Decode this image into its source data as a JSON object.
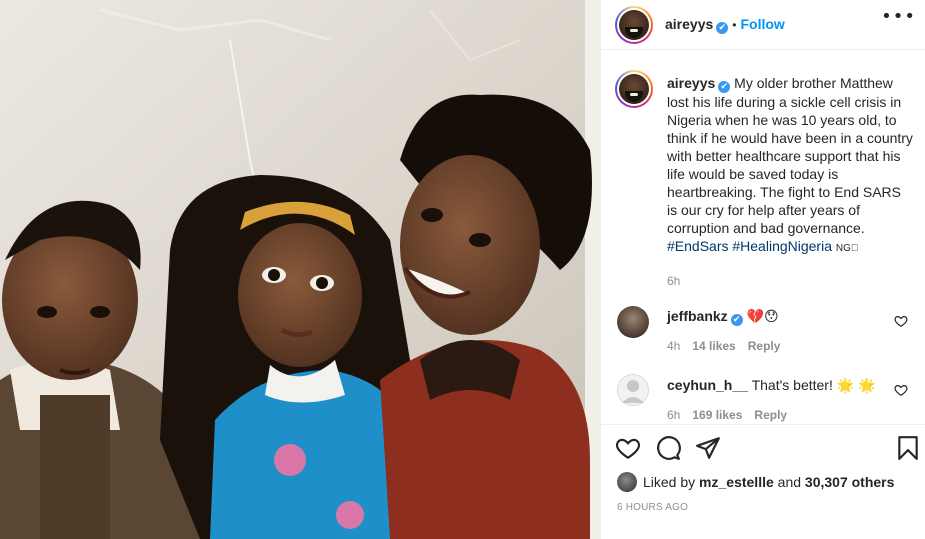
{
  "post": {
    "username": "aireyys",
    "verified_mark": "✔",
    "separator": "•",
    "follow_label": "Follow",
    "more_label": "•••",
    "caption_username": "aireyys",
    "caption_body": "My older brother Matthew lost his life during a sickle cell crisis in Nigeria when he was 10 years old, to think if he would have been in a country with better healthcare support that his life would be saved today is heartbreaking. The fight to End SARS is our cry for help after years of corruption and bad governance.",
    "hashtag_1": "#EndSars",
    "hashtag_2": "#HealingNigeria",
    "flag_text": "NG⃞",
    "caption_age": "6h"
  },
  "comments": [
    {
      "username": "jeffbankz",
      "text": "💔😯",
      "age": "4h",
      "likes": "14 likes",
      "reply": "Reply"
    },
    {
      "username": "ceyhun_h__",
      "text": "That's better! 🌟 🌟",
      "age": "6h",
      "likes": "169 likes",
      "reply": "Reply"
    }
  ],
  "actions": {
    "icons": [
      "heart-icon",
      "comment-icon",
      "share-icon",
      "bookmark-icon"
    ],
    "liked_prefix": "Liked by",
    "liked_user": "mz_estellle",
    "liked_and": "and",
    "liked_others": "30,307 others",
    "timestamp": "6 HOURS AGO"
  },
  "colors": {
    "link_blue": "#0095f6",
    "verified_blue": "#3897f0",
    "hashtag": "#00376b",
    "meta_gray": "#8e8e8e"
  }
}
